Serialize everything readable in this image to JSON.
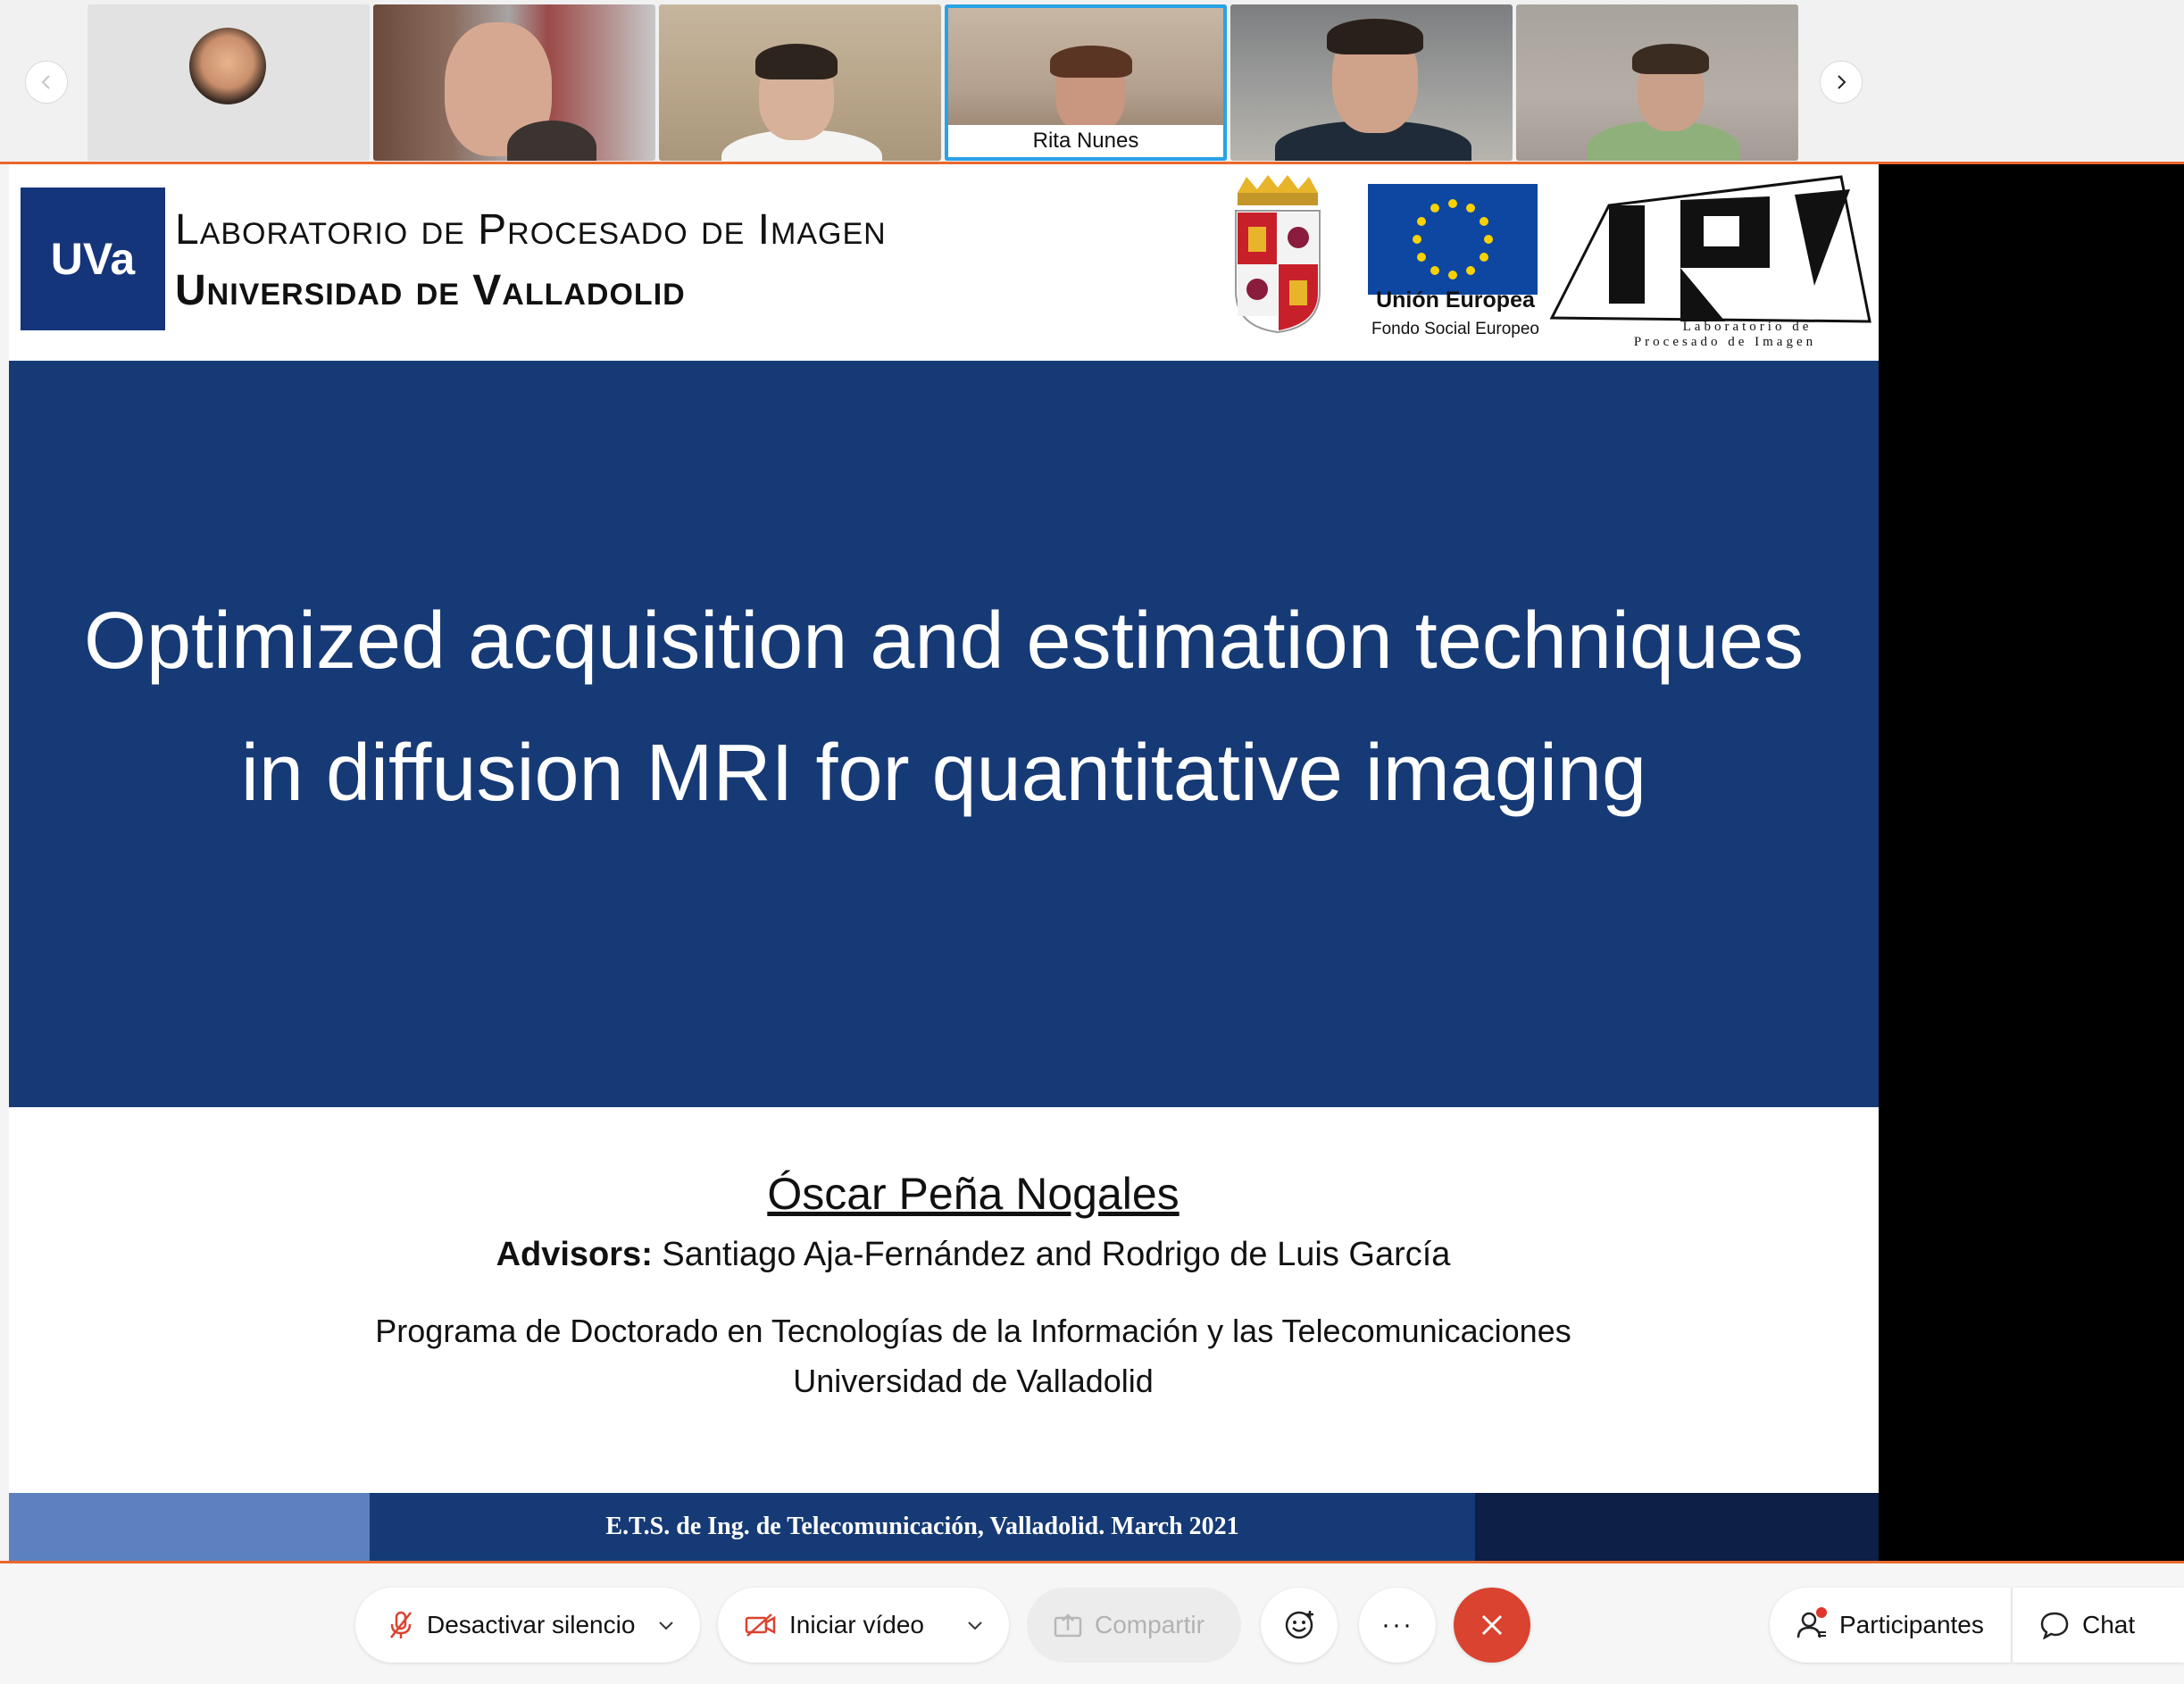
{
  "participants": {
    "tiles": [
      {
        "name": ""
      },
      {
        "name": ""
      },
      {
        "name": ""
      },
      {
        "name": "Rita Nunes",
        "active": true
      },
      {
        "name": ""
      },
      {
        "name": ""
      }
    ],
    "prev_icon": "chevron-left-icon",
    "next_icon": "chevron-right-icon"
  },
  "slide": {
    "logo_text": "UVa",
    "lab_line_1": "Laboratorio de Procesado de Imagen",
    "lab_line_2": "Universidad de Valladolid",
    "eu_title": "Unión Europea",
    "eu_subtitle": "Fondo Social Europeo",
    "lpi_logo_text": "LPI",
    "lpi_logo_caption_1": "Laboratorio de",
    "lpi_logo_caption_2": "Procesado de Imagen",
    "title": "Optimized acquisition and estimation techniques\nin diffusion MRI for quantitative imaging",
    "author": "Óscar Peña Nogales",
    "advisors_label": "Advisors:",
    "advisors_names": "Santiago Aja-Fernández and Rodrigo de Luis García",
    "program": "Programa de Doctorado en Tecnologías de la Información y las Telecomunicaciones",
    "university": "Universidad de Valladolid",
    "footer": "E.T.S. de Ing. de Telecomunicación, Valladolid. March 2021"
  },
  "toolbar": {
    "mute_label": "Desactivar silencio",
    "video_label": "Iniciar vídeo",
    "share_label": "Compartir",
    "participants_label": "Participantes",
    "chat_label": "Chat",
    "more_label": "···"
  },
  "colors": {
    "accent_orange": "#e9682d",
    "slide_blue": "#163a75",
    "leave_red": "#d9432f",
    "active_tile_border": "#29a2e6"
  }
}
